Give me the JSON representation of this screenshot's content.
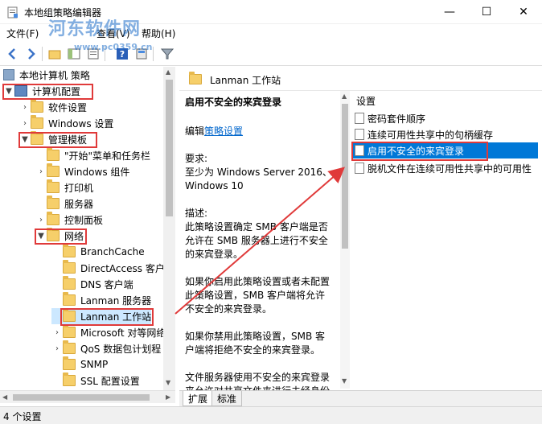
{
  "window": {
    "title": "本地组策略编辑器",
    "minimize": "—",
    "maximize": "☐",
    "close": "✕"
  },
  "watermark": {
    "text": "河东软件网",
    "url": "www.pc0359.cn"
  },
  "menu": [
    {
      "label": "文件(F)"
    },
    {
      "label": "查看(V)"
    },
    {
      "label": "帮助(H)"
    }
  ],
  "tree": {
    "root": "本地计算机 策略",
    "computer_config": "计算机配置",
    "software_settings": "软件设置",
    "windows_settings": "Windows 设置",
    "admin_templates": "管理模板",
    "start_menu": "\"开始\"菜单和任务栏",
    "windows_components": "Windows 组件",
    "printers": "打印机",
    "server": "服务器",
    "control_panel": "控制面板",
    "network": "网络",
    "branchcache": "BranchCache",
    "directaccess": "DirectAccess 客户",
    "dns_client": "DNS 客户端",
    "lanman_server": "Lanman 服务器",
    "lanman_workstation": "Lanman 工作站",
    "microsoft_p2p": "Microsoft 对等网络",
    "qos": "QoS 数据包计划程",
    "snmp": "SNMP",
    "ssl": "SSL 配置设置"
  },
  "right": {
    "header": "Lanman 工作站",
    "desc_title": "启用不安全的来宾登录",
    "edit_prefix": "编辑",
    "edit_link": "策略设置",
    "req_label": "要求:",
    "req_line1": "至少为 Windows Server 2016、",
    "req_line2": "Windows 10",
    "desc_label": "描述:",
    "desc1": "此策略设置确定 SMB 客户端是否允许在 SMB 服务器上进行不安全的来宾登录。",
    "desc2": "如果你启用此策略设置或者未配置此策略设置，SMB 客户端将允许不安全的来宾登录。",
    "desc3": "如果你禁用此策略设置，SMB 客户端将拒绝不安全的来宾登录。",
    "desc4": "文件服务器使用不安全的来宾登录来允许对共享文件夹进行未经身份"
  },
  "settings": {
    "header": "设置",
    "items": [
      {
        "label": "密码套件顺序"
      },
      {
        "label": "连续可用性共享中的句柄缓存"
      },
      {
        "label": "启用不安全的来宾登录"
      },
      {
        "label": "脱机文件在连续可用性共享中的可用性"
      }
    ]
  },
  "tabs": {
    "extended": "扩展",
    "standard": "标准"
  },
  "status": {
    "text": "4 个设置"
  },
  "colors": {
    "highlight_box": "#e03a3a",
    "selection": "#cce8ff",
    "selected_item": "#0078d7",
    "link": "#0066cc"
  }
}
